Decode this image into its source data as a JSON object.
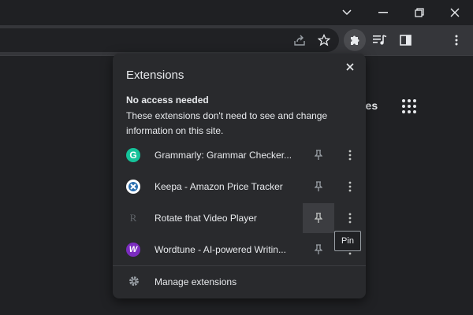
{
  "window": {
    "minimize_icon": "minimize-icon",
    "maximize_icon": "restore-icon",
    "close_icon": "close-icon",
    "tabsearch_icon": "chevron-down-icon"
  },
  "toolbar": {
    "icons": [
      "share-icon",
      "star-icon",
      "puzzle-icon",
      "media-icon",
      "sidepanel-icon",
      "more-vertical-icon"
    ]
  },
  "page": {
    "partial_link": "ges"
  },
  "extensions_panel": {
    "title": "Extensions",
    "section_heading": "No access needed",
    "section_description": "These extensions don't need to see and change information on this site.",
    "items": [
      {
        "name": "Grammarly: Grammar Checker...",
        "logo": "G",
        "logo_color": "#15c39a"
      },
      {
        "name": "Keepa - Amazon Price Tracker",
        "logo": "keepa-logo",
        "logo_color": "#ffffff"
      },
      {
        "name": "Rotate that Video Player",
        "logo": "R",
        "logo_color": "#3a3b3e"
      },
      {
        "name": "Wordtune - AI-powered Writin...",
        "logo": "W",
        "logo_color": "#7b2cbf"
      }
    ],
    "manage_label": "Manage extensions",
    "tooltip": "Pin"
  }
}
